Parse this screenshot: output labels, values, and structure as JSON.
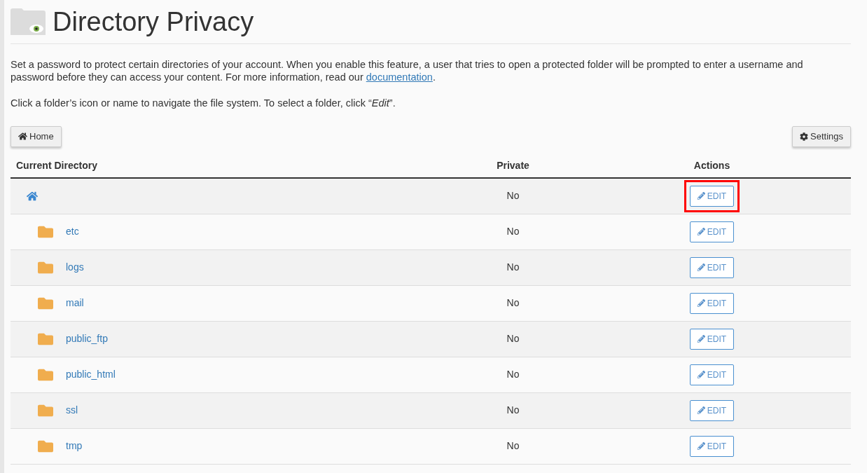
{
  "title": "Directory Privacy",
  "intro": "Set a password to protect certain directories of your account. When you enable this feature, a user that tries to open a protected folder will be prompted to enter a username and password before they can access your content. For more information, read our ",
  "intro_link": "documentation",
  "intro_end": ".",
  "hint": "Click a folder’s icon or name to navigate the file system. To select a folder, click “*Edit*”.",
  "home_button": "Home",
  "settings_button": "Settings",
  "table": {
    "columns": [
      "Current Directory",
      "Private",
      "Actions"
    ],
    "rows": [
      {
        "kind": "home",
        "name": "",
        "private": "No",
        "action": "EDIT",
        "highlighted": true
      },
      {
        "kind": "folder",
        "name": "etc",
        "private": "No",
        "action": "EDIT",
        "highlighted": false
      },
      {
        "kind": "folder",
        "name": "logs",
        "private": "No",
        "action": "EDIT",
        "highlighted": false
      },
      {
        "kind": "folder",
        "name": "mail",
        "private": "No",
        "action": "EDIT",
        "highlighted": false
      },
      {
        "kind": "folder",
        "name": "public_ftp",
        "private": "No",
        "action": "EDIT",
        "highlighted": false
      },
      {
        "kind": "folder",
        "name": "public_html",
        "private": "No",
        "action": "EDIT",
        "highlighted": false
      },
      {
        "kind": "folder",
        "name": "ssl",
        "private": "No",
        "action": "EDIT",
        "highlighted": false
      },
      {
        "kind": "folder",
        "name": "tmp",
        "private": "No",
        "action": "EDIT",
        "highlighted": false
      }
    ]
  }
}
